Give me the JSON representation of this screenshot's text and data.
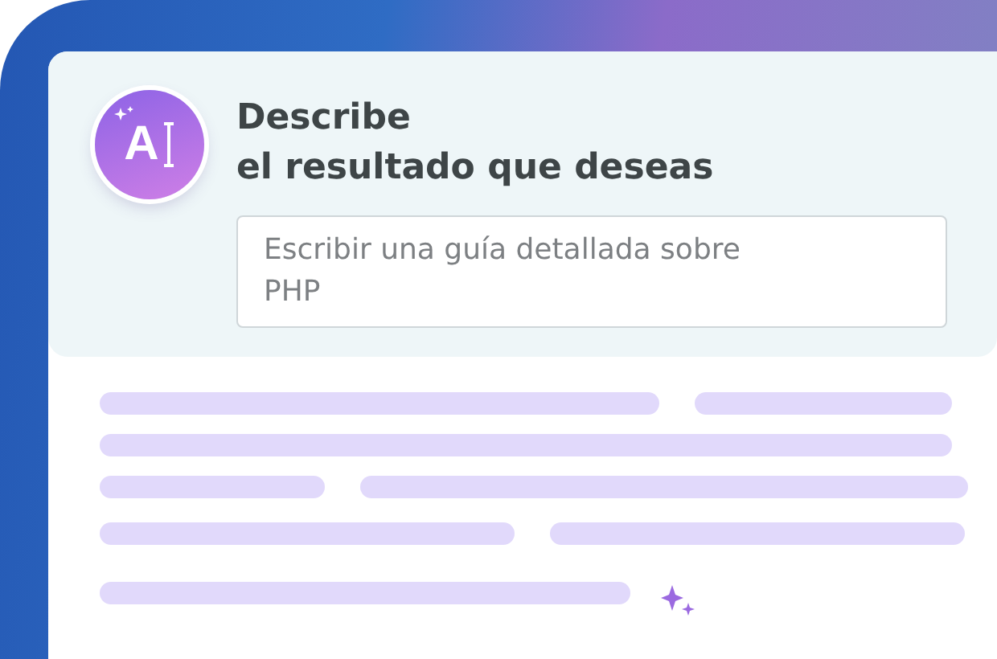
{
  "logo": {
    "letter": "A"
  },
  "heading": {
    "line_1": "Describe",
    "line_2": "el resultado que deseas"
  },
  "prompt_field": {
    "placeholder": "Escribir una guía detallada sobre PHP"
  }
}
